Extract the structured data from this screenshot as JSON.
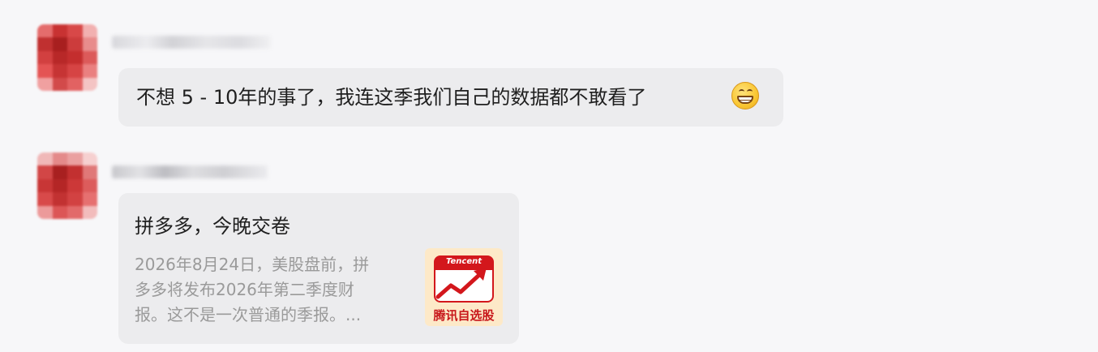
{
  "messages": [
    {
      "sender": "",
      "text": "不想 5 - 10年的事了，我连这季我们自己的数据都不敢看了",
      "emoji": "grinning-face-icon"
    },
    {
      "sender": "",
      "card": {
        "title": "拼多多，今晚交卷",
        "desc_lines": [
          "2026年8月24日，美股盘前，拼",
          "多多将发布2026年第二季度财",
          "报。这不是一次普通的季报。..."
        ],
        "thumb_brand": "Tencent",
        "thumb_label": "腾讯自选股"
      }
    }
  ],
  "colors": {
    "background": "#f7f7f9",
    "bubble": "#ececee",
    "thumb_bg": "#fde9c8",
    "tencent_red": "#d3171c"
  }
}
